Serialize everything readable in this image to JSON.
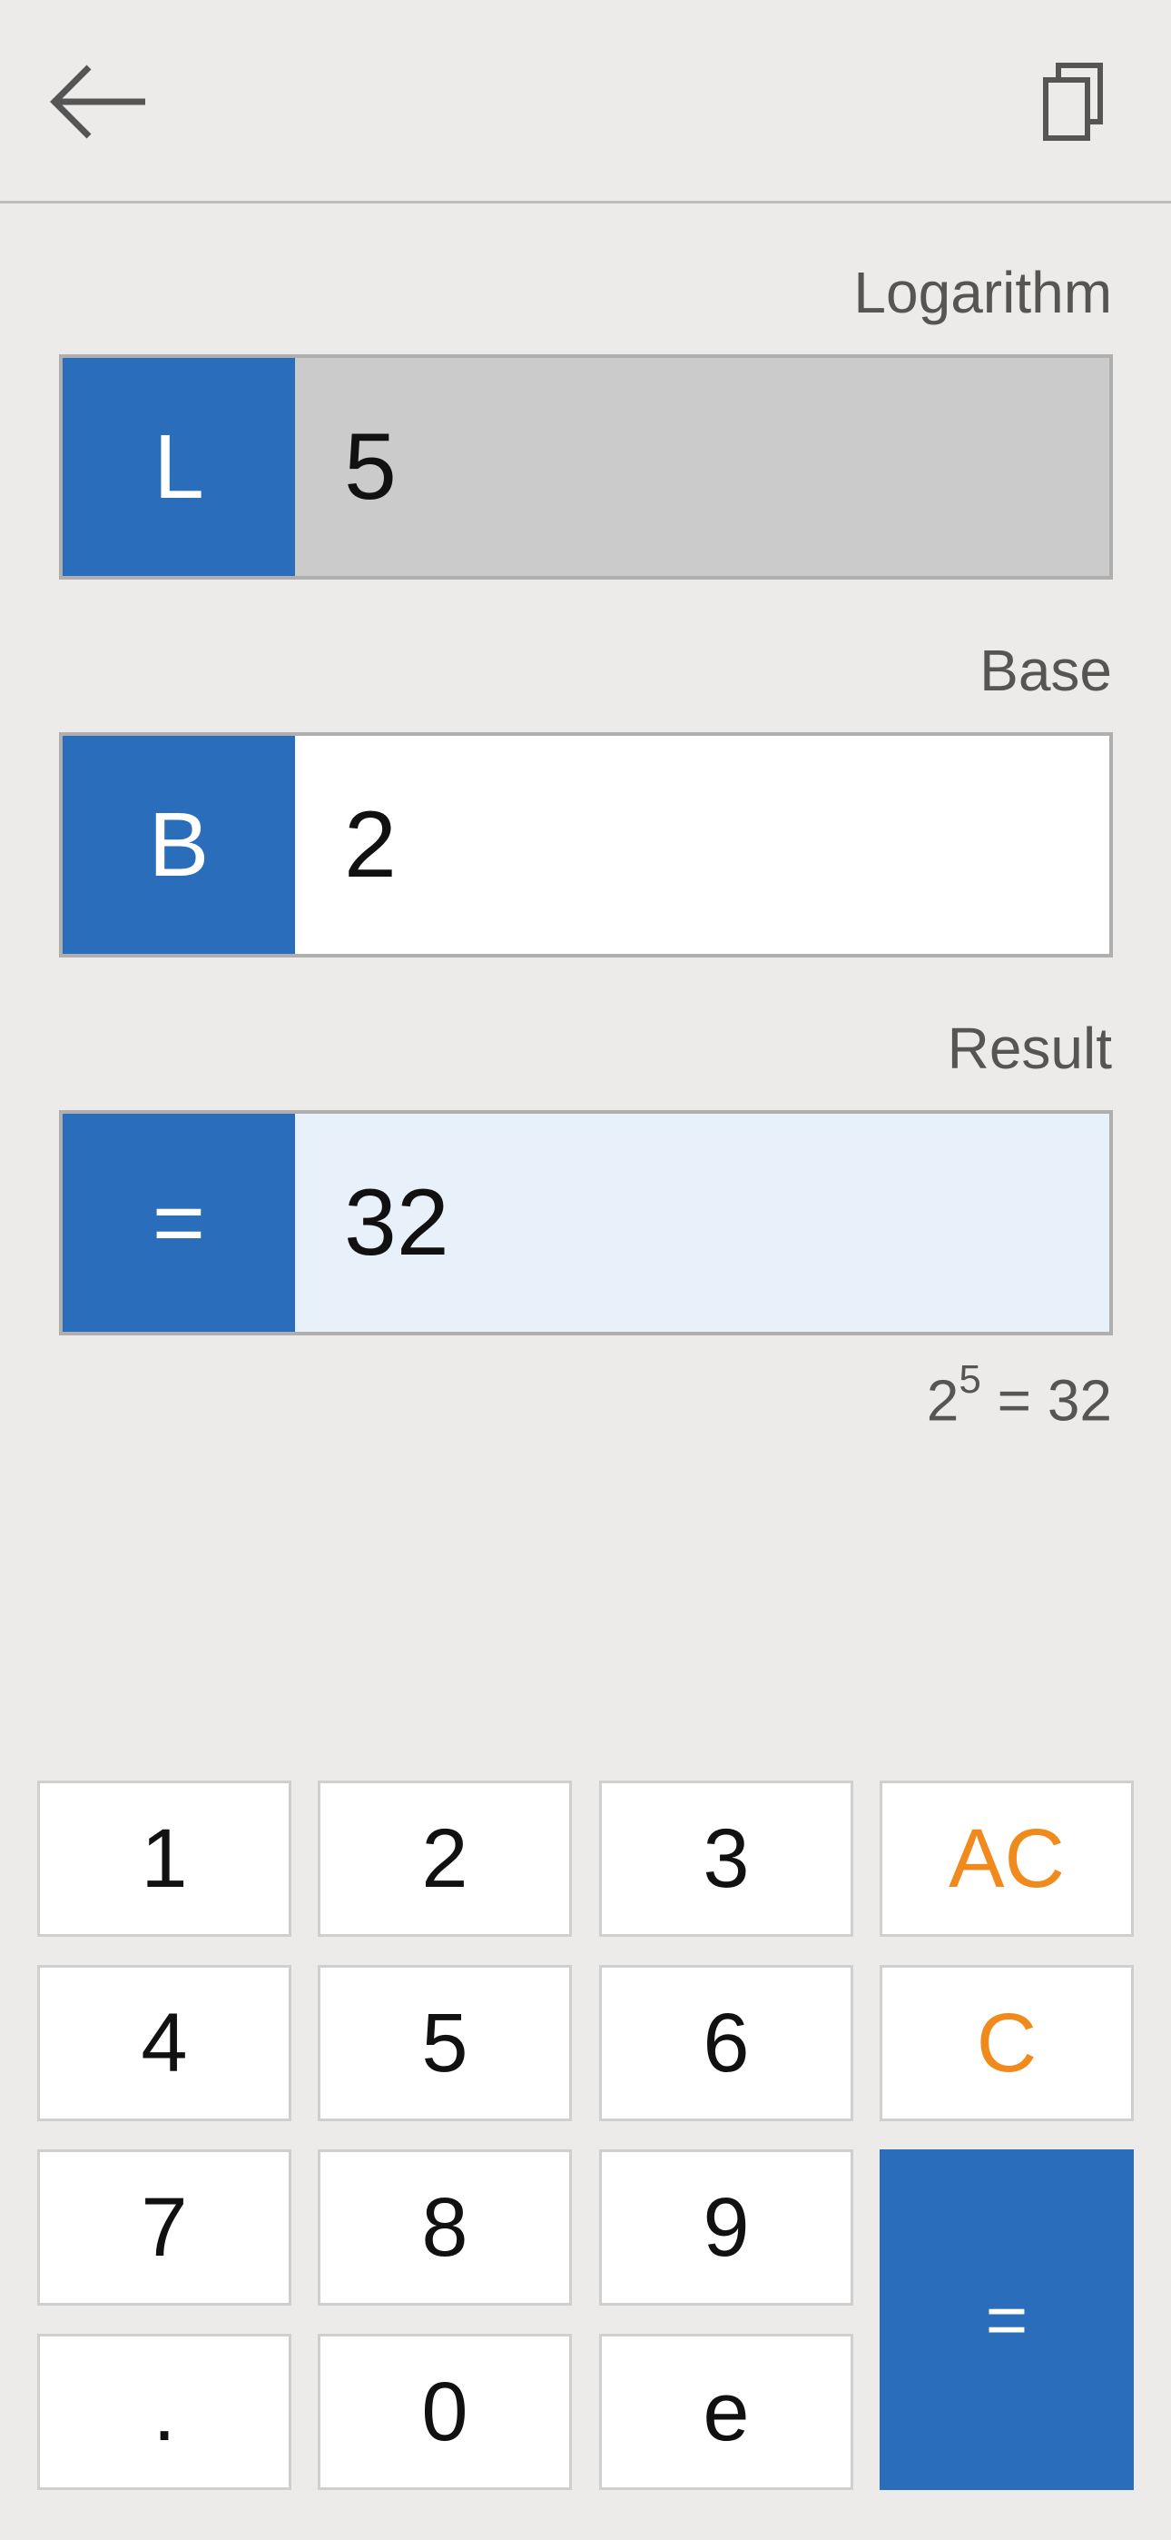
{
  "header": {
    "back_icon": "arrow-left-icon",
    "copy_icon": "copy-icon"
  },
  "logarithm": {
    "label": "Logarithm",
    "tag": "L",
    "value": "5"
  },
  "base": {
    "label": "Base",
    "tag": "B",
    "value": "2"
  },
  "result": {
    "label": "Result",
    "tag": "=",
    "value": "32"
  },
  "formula": {
    "base": "2",
    "exponent": "5",
    "rest": " = 32"
  },
  "keypad": {
    "k1": "1",
    "k2": "2",
    "k3": "3",
    "ac": "AC",
    "k4": "4",
    "k5": "5",
    "k6": "6",
    "c": "C",
    "k7": "7",
    "k8": "8",
    "k9": "9",
    "equals": "=",
    "dot": ".",
    "k0": "0",
    "e": "e"
  },
  "colors": {
    "accent": "#2A6EBB",
    "clear_keys": "#F08A1C",
    "background": "#ECEBE9"
  }
}
